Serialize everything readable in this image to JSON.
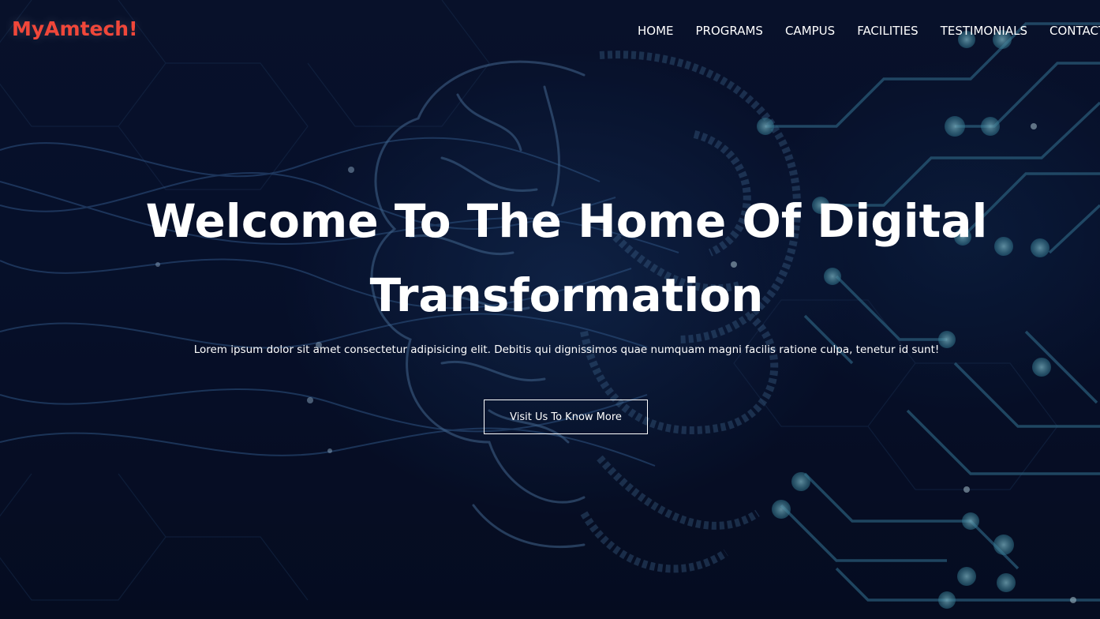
{
  "brand": {
    "name": "MyAmtech!",
    "color": "#f0473a"
  },
  "nav": {
    "items": [
      {
        "label": "HOME"
      },
      {
        "label": "PROGRAMS"
      },
      {
        "label": "CAMPUS"
      },
      {
        "label": "FACILITIES"
      },
      {
        "label": "TESTIMONIALS"
      },
      {
        "label": "CONTACT"
      }
    ]
  },
  "hero": {
    "title": "Welcome To The Home Of Digital Transformation",
    "description": "Lorem ipsum dolor sit amet consectetur adipisicing elit. Debitis qui dignissimos quae numquam magni facilis ratione culpa, tenetur id sunt!",
    "cta_label": "Visit Us To Know More"
  },
  "colors": {
    "background": "#070f24",
    "text": "#ffffff",
    "circuit": "#5fb3c9"
  }
}
